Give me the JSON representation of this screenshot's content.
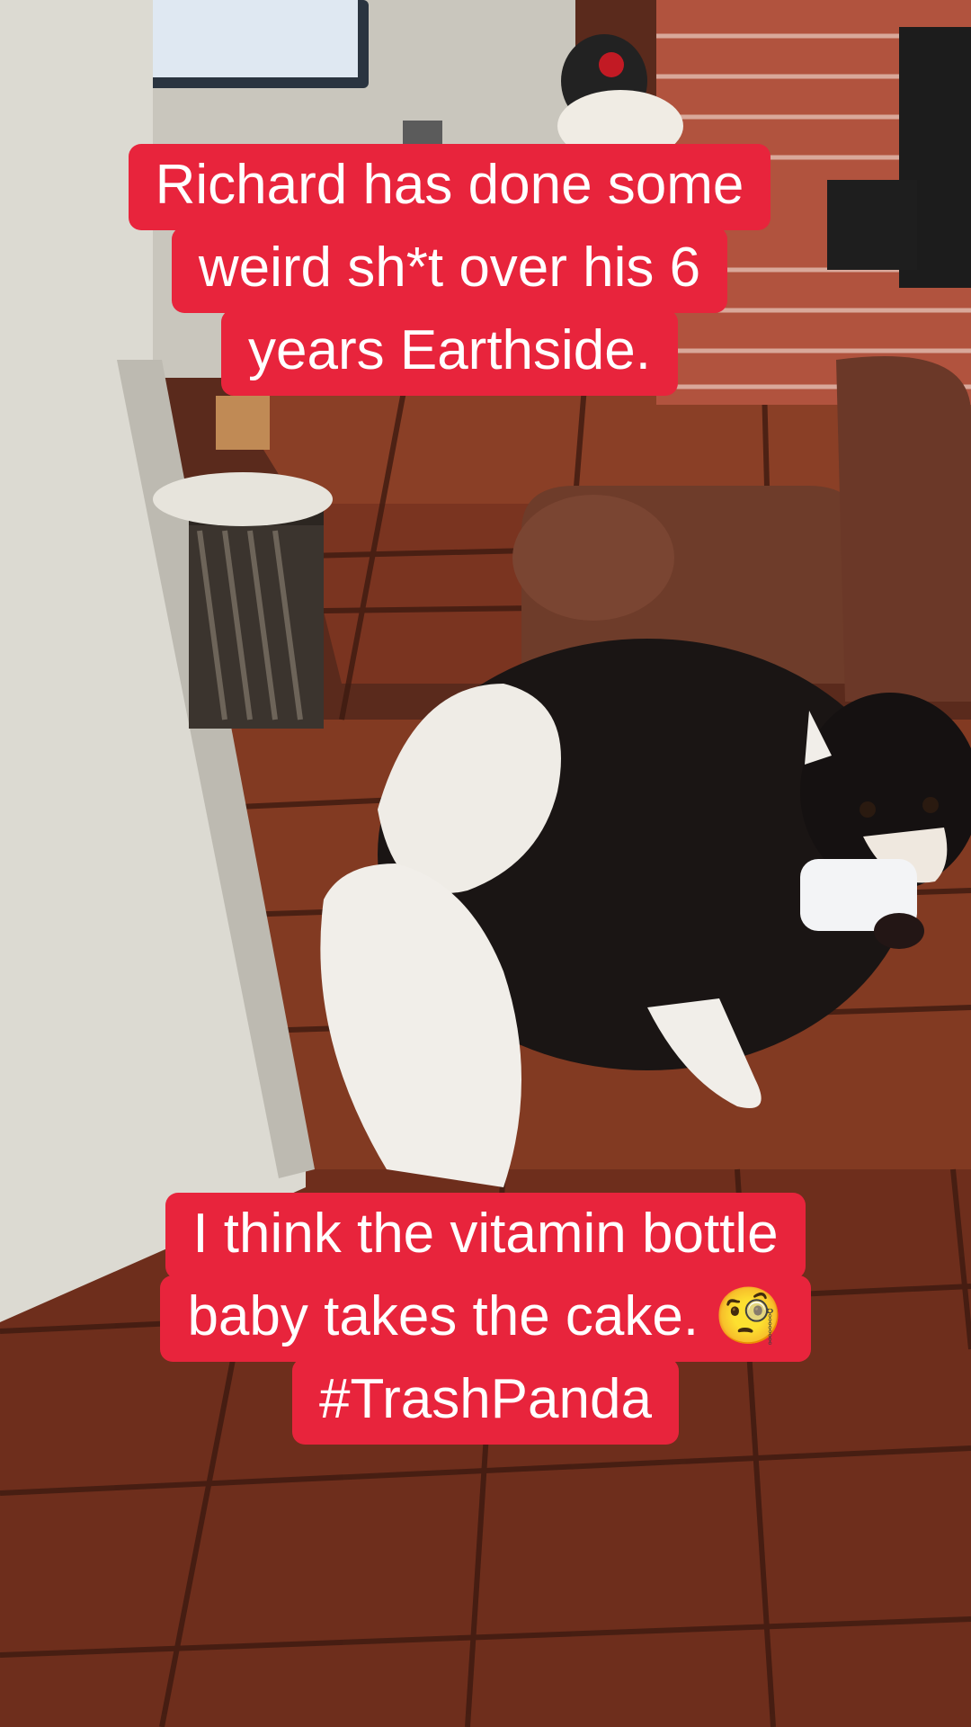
{
  "captions": {
    "top": {
      "line1": "Richard has done some",
      "line2": "weird sh*t over his 6",
      "line3": "years Earthside."
    },
    "bottom": {
      "line1": "I think the vitamin bottle",
      "line2": "baby takes the cake. 🧐",
      "line3": "#TrashPanda"
    }
  },
  "colors": {
    "caption_background": "#e8243c",
    "caption_text": "#ffffff"
  }
}
